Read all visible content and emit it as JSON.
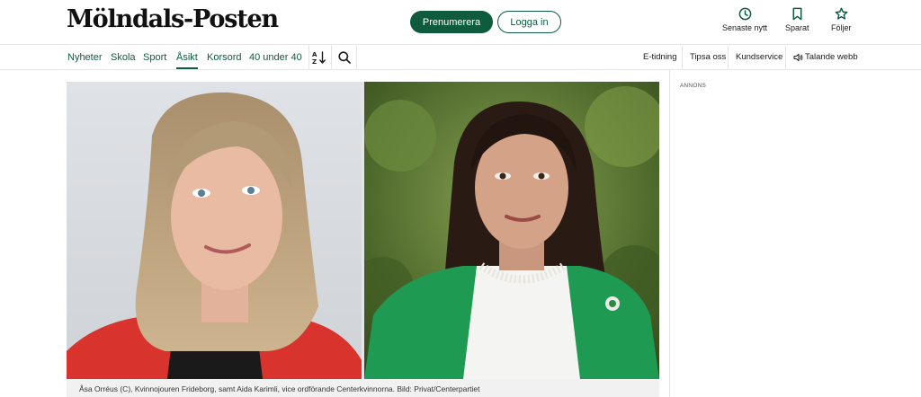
{
  "header": {
    "logo": "Mölndals-Posten",
    "subscribe_label": "Prenumerera",
    "login_label": "Logga in",
    "tools": [
      {
        "label": "Senaste nytt",
        "icon": "clock-icon"
      },
      {
        "label": "Sparat",
        "icon": "bookmark-icon"
      },
      {
        "label": "Följer",
        "icon": "star-icon"
      }
    ]
  },
  "nav": {
    "items": [
      "Nyheter",
      "Skola",
      "Sport",
      "Åsikt",
      "Korsord",
      "40 under 40"
    ],
    "active": "Åsikt",
    "icons": [
      "sort-az-icon",
      "search-icon"
    ],
    "utility": [
      "E-tidning",
      "Tipsa oss",
      "Kundservice",
      "Talande webb"
    ]
  },
  "article": {
    "caption": "Åsa Orréus (C), Kvinnojouren Frideborg, samt Aida Karimli, vice ordförande Centerkvinnorna. Bild: Privat/Centerpartiet"
  },
  "sidebar": {
    "ad_label": "ANNONS"
  },
  "colors": {
    "brand": "#0e5b3e",
    "divider": "#e6e6e6"
  }
}
